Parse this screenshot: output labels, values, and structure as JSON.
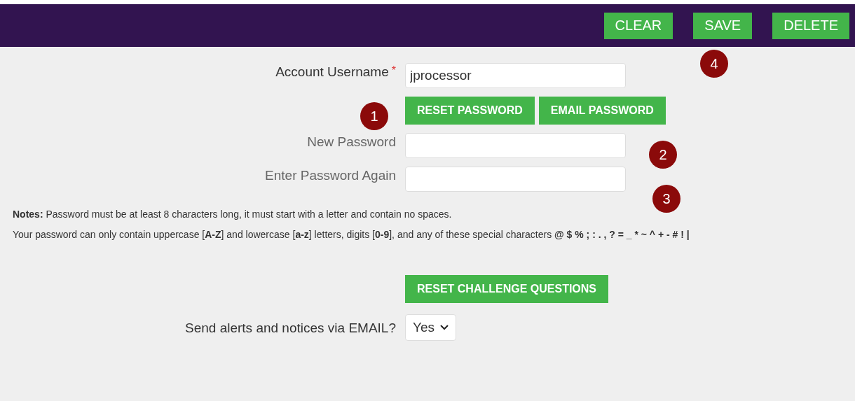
{
  "toolbar": {
    "buttons": [
      "CLEAR",
      "SAVE",
      "DELETE"
    ]
  },
  "username": {
    "label": "Account Username",
    "required_mark": "*",
    "value": "jprocessor"
  },
  "password_buttons": [
    "RESET PASSWORD",
    "EMAIL PASSWORD"
  ],
  "new_password": {
    "label": "New Password"
  },
  "password_again": {
    "label": "Enter Password Again"
  },
  "notes": [
    "**Notes:** Password must be at least 8 characters long, it must start with a letter and contain no spaces.",
    "Your password can only contain uppercase [**A-Z**] and lowercase [**a-z**] letters, digits [**0-9**], and any of these special characters **@ $ % ; : . , ? = _ * ~ ^ + - # ! |**"
  ],
  "challenge_button": "RESET CHALLENGE QUESTIONS",
  "alerts": {
    "label": "Send alerts and notices via EMAIL?",
    "value": "Yes"
  },
  "markers": [
    "1",
    "2",
    "3",
    "4"
  ]
}
